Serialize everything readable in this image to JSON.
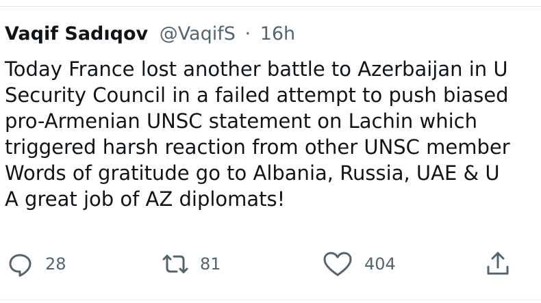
{
  "tweet": {
    "author_name": "Vaqif Sadıqov",
    "handle": "@VaqifS",
    "separator": "·",
    "time": "16h",
    "text_lines": [
      "Today France lost another battle to Azerbaijan in U",
      "Security Council in a failed attempt to push biased",
      "pro-Armenian UNSC statement on Lachin which",
      "triggered harsh reaction from other UNSC member",
      "Words of gratitude go to Albania, Russia, UAE & U",
      "A great job of AZ diplomats!"
    ],
    "actions": {
      "reply_icon": "reply-bubble-icon",
      "reply_count": "28",
      "retweet_icon": "retweet-arrows-icon",
      "retweet_count": "81",
      "like_icon": "heart-icon",
      "like_count": "404",
      "share_icon": "share-upload-icon"
    }
  },
  "colors": {
    "text_primary": "#0f1419",
    "text_secondary": "#536471",
    "divider": "#e6e9ec",
    "background": "#ffffff"
  }
}
